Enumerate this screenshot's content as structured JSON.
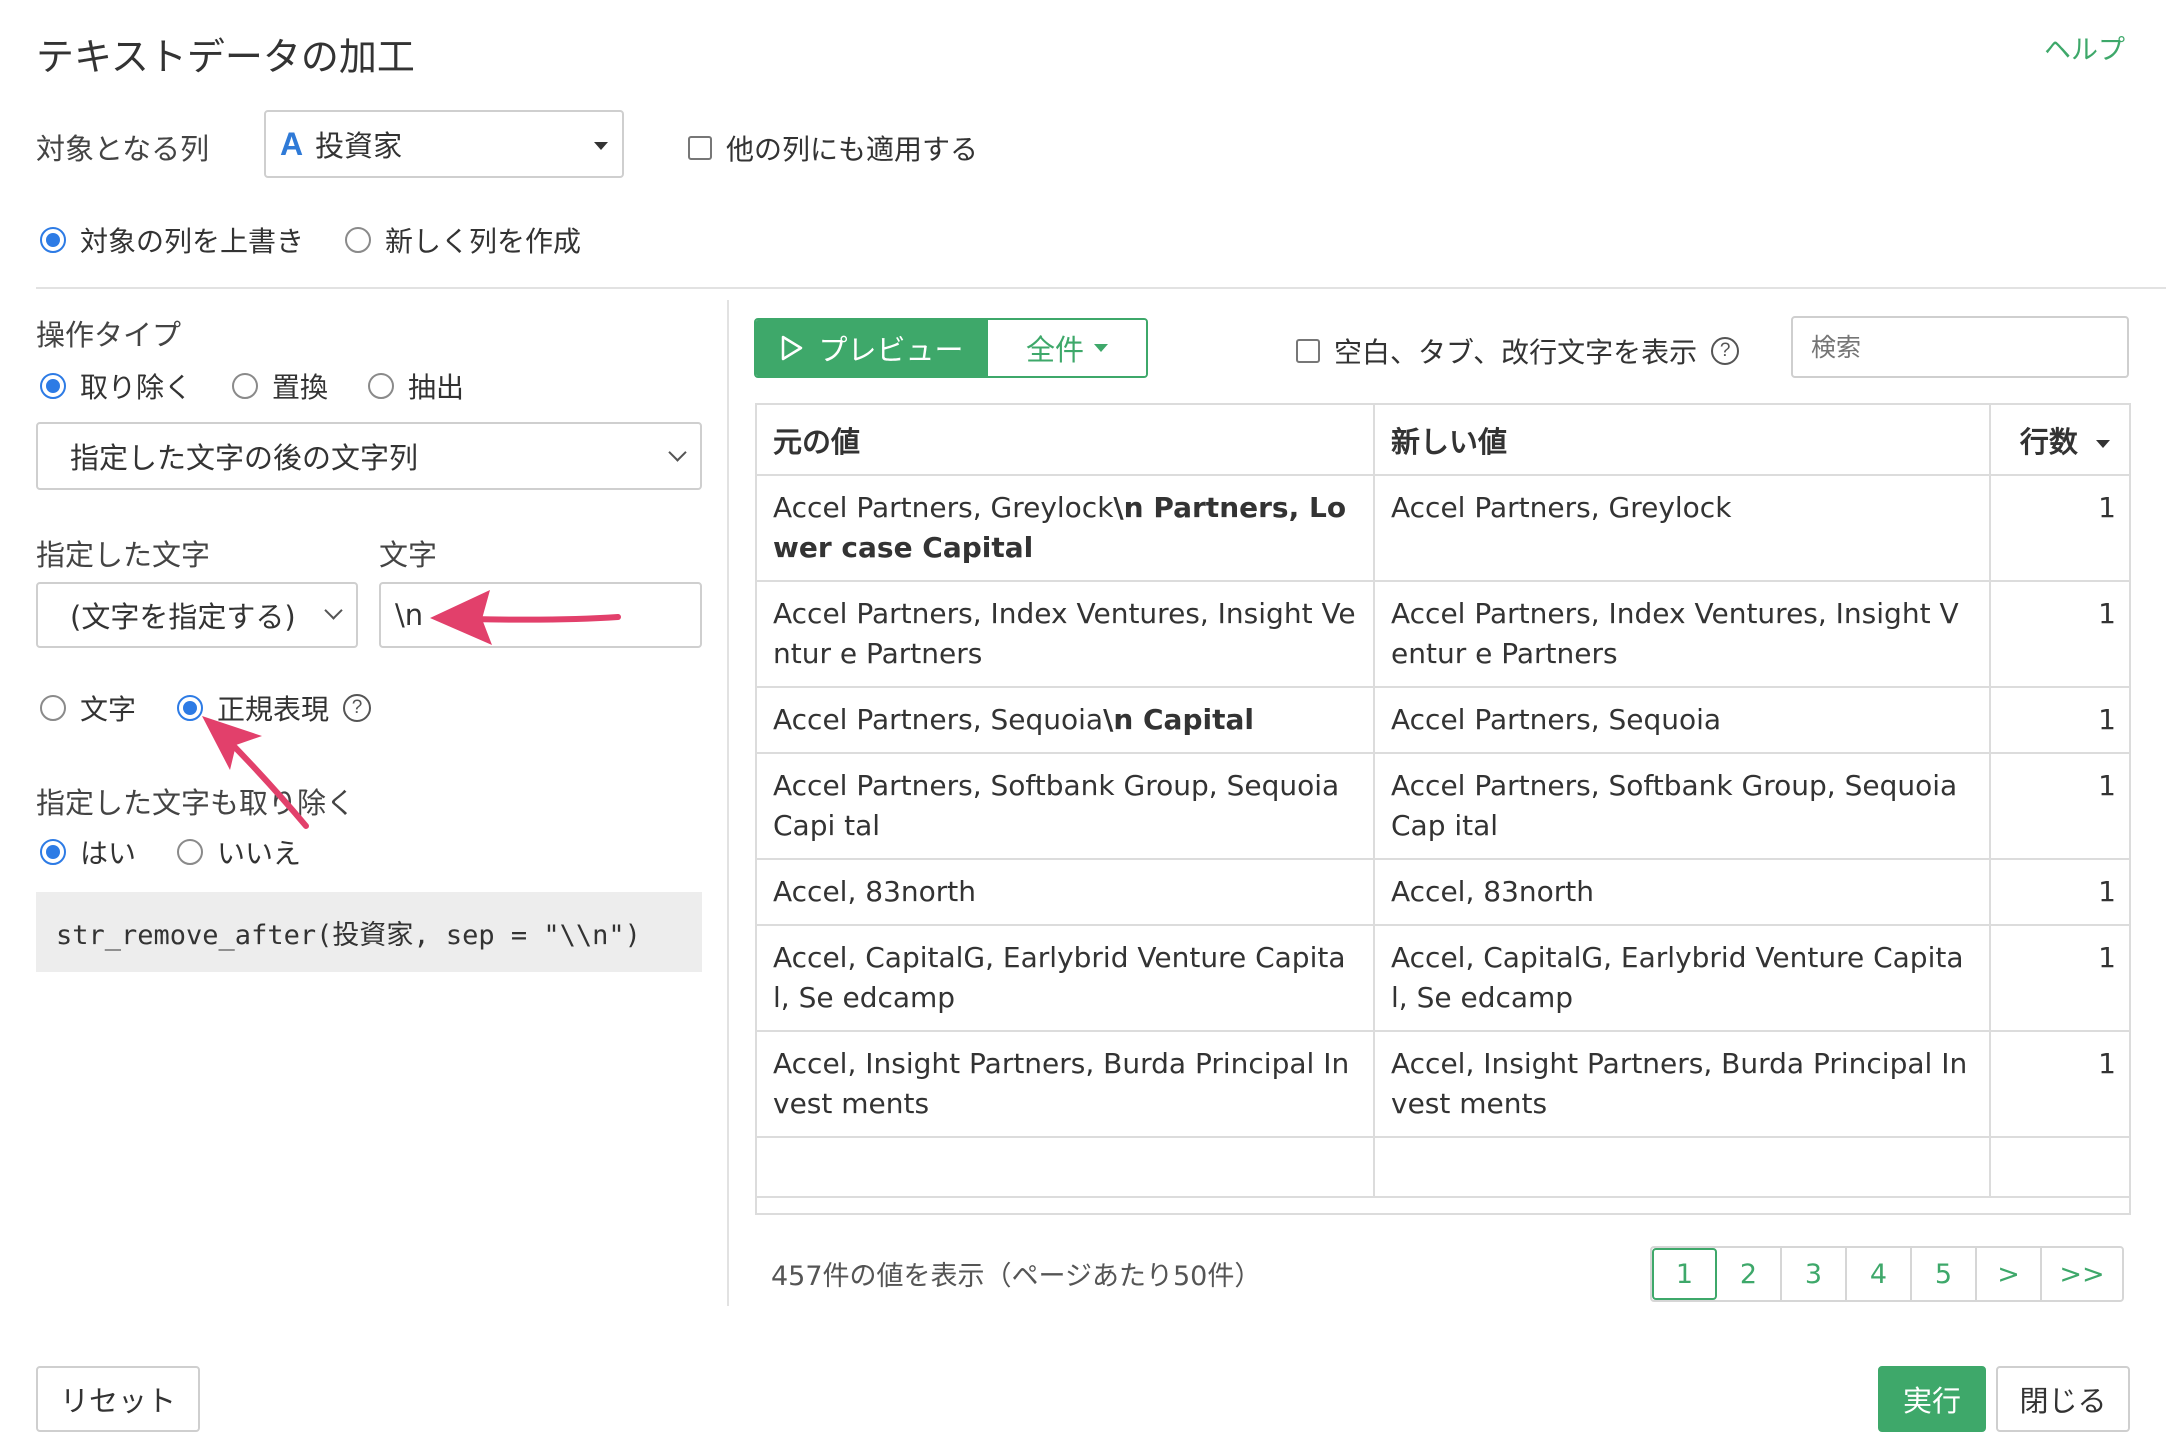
{
  "dialog": {
    "title": "テキストデータの加工",
    "help_label": "ヘルプ"
  },
  "target": {
    "label": "対象となる列",
    "column_type_icon": "A",
    "column_value": "投資家",
    "apply_other_label": "他の列にも適用する",
    "overwrite_label": "対象の列を上書き",
    "new_column_label": "新しく列を作成",
    "selected_mode": "overwrite"
  },
  "operation": {
    "label": "操作タイプ",
    "options": [
      "取り除く",
      "置換",
      "抽出"
    ],
    "selected": "取り除く",
    "subtype_value": "指定した文字の後の文字列"
  },
  "specified": {
    "label": "指定した文字",
    "select_value": "(文字を指定する)",
    "char_label": "文字",
    "char_value": "\\n",
    "mode_text_label": "文字",
    "mode_regex_label": "正規表現",
    "selected_mode": "正規表現"
  },
  "remove_specified": {
    "label": "指定した文字も取り除く",
    "yes_label": "はい",
    "no_label": "いいえ",
    "selected": "はい"
  },
  "code": "str_remove_after(投資家, sep = \"\\\\n\")",
  "preview": {
    "preview_label": "プレビュー",
    "all_label": "全件",
    "show_whitespace_label": "空白、タブ、改行文字を表示",
    "search_placeholder": "検索"
  },
  "table": {
    "headers": [
      "元の値",
      "新しい値",
      "行数"
    ],
    "rows": [
      {
        "orig_plain": "Accel Partners, Greylock",
        "orig_bold": "\\n   Partners, Lower case Capital",
        "new": "Accel Partners, Greylock",
        "count": "1"
      },
      {
        "orig_plain": "Accel Partners, Index Ventures, Insight Ventur e Partners",
        "orig_bold": "",
        "new": "Accel Partners, Index Ventures, Insight Ventur e Partners",
        "count": "1"
      },
      {
        "orig_plain": "Accel Partners, Sequoia",
        "orig_bold": "\\n   Capital",
        "new": "Accel Partners, Sequoia",
        "count": "1"
      },
      {
        "orig_plain": "Accel Partners, Softbank Group, Sequoia Capi tal",
        "orig_bold": "",
        "new": "Accel Partners, Softbank Group, Sequoia Cap ital",
        "count": "1"
      },
      {
        "orig_plain": "Accel, 83north",
        "orig_bold": "",
        "new": "Accel, 83north",
        "count": "1"
      },
      {
        "orig_plain": "Accel, CapitalG, Earlybrid Venture Capital, Se edcamp",
        "orig_bold": "",
        "new": "Accel, CapitalG, Earlybrid Venture Capital, Se edcamp",
        "count": "1"
      },
      {
        "orig_plain": "Accel, Insight Partners, Burda Principal Invest ments",
        "orig_bold": "",
        "new": "Accel, Insight Partners, Burda Principal Invest ments",
        "count": "1"
      }
    ]
  },
  "summary": "457件の値を表示（ページあたり50件）",
  "pagination": {
    "pages": [
      "1",
      "2",
      "3",
      "4",
      "5",
      ">",
      ">>"
    ],
    "current": "1"
  },
  "footer": {
    "reset_label": "リセット",
    "run_label": "実行",
    "close_label": "閉じる"
  },
  "colors": {
    "accent": "#3ea86a",
    "radio": "#2d7be5",
    "annotation_arrow": "#e2406b"
  },
  "icons": [
    "search-icon",
    "clear-icon",
    "play-icon",
    "question-icon",
    "caret-down-icon",
    "chevron-down-icon"
  ]
}
